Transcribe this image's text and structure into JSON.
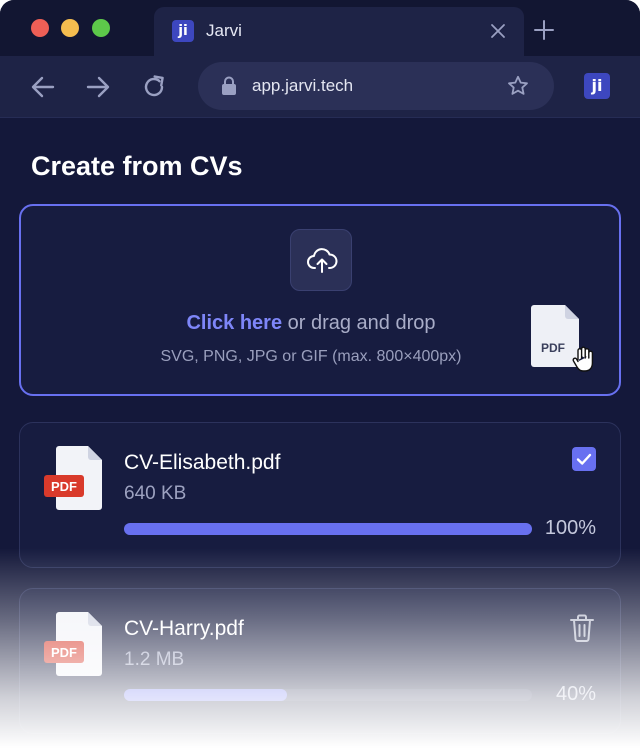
{
  "browser": {
    "tab_title": "Jarvi",
    "tab_logo_text": "ji",
    "url": "app.jarvi.tech",
    "extension_logo_text": "ji"
  },
  "page": {
    "title": "Create from CVs"
  },
  "dropzone": {
    "link_text": "Click here",
    "rest_text": " or drag and drop",
    "hint": "SVG, PNG, JPG or GIF (max. 800×400px)",
    "file_badge": "PDF"
  },
  "files": [
    {
      "name": "CV-Elisabeth.pdf",
      "size": "640 KB",
      "badge": "PDF",
      "progress": 100,
      "progress_label": "100%",
      "status": "complete"
    },
    {
      "name": "CV-Harry.pdf",
      "size": "1.2 MB",
      "badge": "PDF",
      "progress": 40,
      "progress_label": "40%",
      "status": "uploading"
    }
  ],
  "colors": {
    "accent": "#6870f0",
    "background": "#14183a",
    "pdf_red": "#d93a2b"
  },
  "icons": {
    "upload": "cloud-upload-icon",
    "check": "check-icon",
    "delete": "trash-icon"
  }
}
